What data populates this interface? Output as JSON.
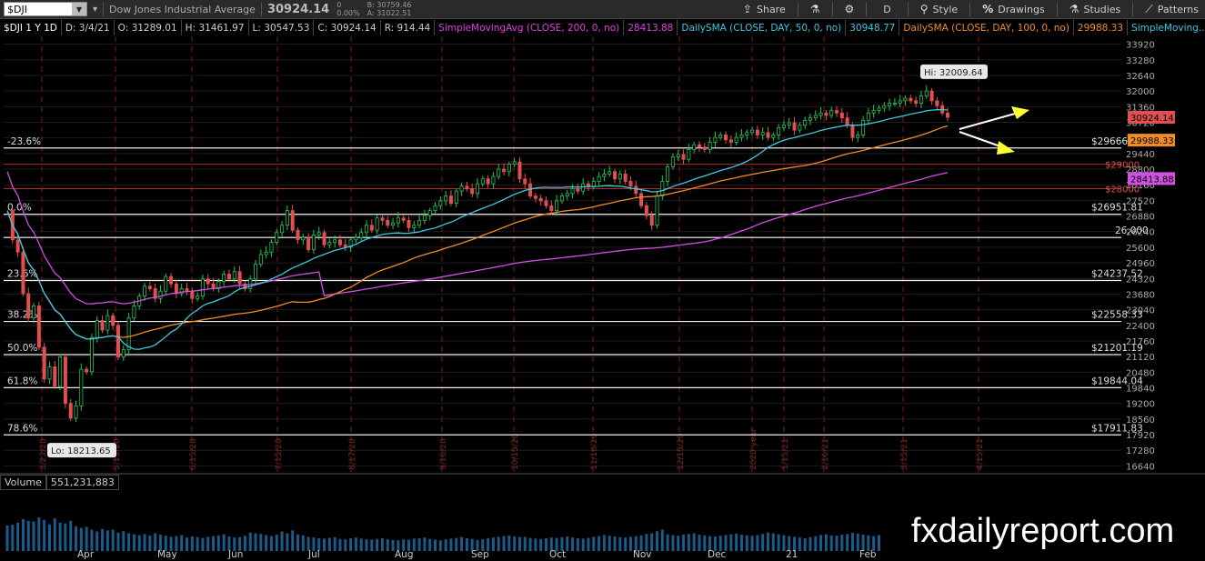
{
  "toolbar": {
    "symbol": "$DJI",
    "company": "Dow Jones Industrial Average",
    "last": "30924.14",
    "change": "0",
    "change_pct": "0.00%",
    "bid": "B: 30759.46",
    "ask": "A: 31022.51",
    "share": "Share",
    "period": "D",
    "style": "Style",
    "drawings": "Drawings",
    "studies": "Studies",
    "patterns": "Patterns"
  },
  "infobar": {
    "items": [
      {
        "text": "$DJI 1 Y 1D",
        "color": "#ffffff"
      },
      {
        "text": "D: 3/4/21",
        "color": "#cccccc"
      },
      {
        "text": "O: 31289.01",
        "color": "#cccccc"
      },
      {
        "text": "H: 31461.97",
        "color": "#cccccc"
      },
      {
        "text": "L: 30547.53",
        "color": "#cccccc"
      },
      {
        "text": "C: 30924.14",
        "color": "#cccccc"
      },
      {
        "text": "R: 914.44",
        "color": "#cccccc"
      },
      {
        "text": "SimpleMovingAvg (CLOSE, 200, 0, no)",
        "color": "#e040e0"
      },
      {
        "text": "28413.88",
        "color": "#e040e0"
      },
      {
        "text": "DailySMA (CLOSE, DAY, 50, 0, no)",
        "color": "#40c8e0"
      },
      {
        "text": "30948.77",
        "color": "#40c8e0"
      },
      {
        "text": "DailySMA (CLOSE, DAY, 100, 0, no)",
        "color": "#f08c28"
      },
      {
        "text": "29988.33",
        "color": "#f08c28"
      },
      {
        "text": "SimpleMoving...",
        "color": "#40c8e0"
      }
    ]
  },
  "colors": {
    "up": "#22c65a",
    "down": "#e05050",
    "sma50": "#3ec8e0",
    "sma100": "#f08c28",
    "sma200": "#d050e0",
    "grid": "#2a2a2a"
  },
  "chart_data": {
    "type": "candlestick",
    "xlabels": [
      "Apr",
      "May",
      "Jun",
      "Jul",
      "Aug",
      "Sep",
      "Oct",
      "Nov",
      "Dec",
      "21",
      "Feb"
    ],
    "date_markers": [
      "3/23/20",
      "5/15/20",
      "6/15/20",
      "7/15/20",
      "8/17/20",
      "9/16/20",
      "10/15/20",
      "11/16/20",
      "12/15/20",
      "2020 year",
      "1/15/21",
      "2/16/21",
      "3/15/21",
      "4/15/21"
    ],
    "yticks": [
      "33920",
      "33280",
      "32640",
      "32000",
      "31360",
      "30720",
      "30080",
      "29440",
      "28800",
      "28160",
      "27520",
      "26880",
      "26240",
      "25600",
      "24960",
      "24320",
      "23680",
      "23040",
      "22400",
      "21760",
      "21120",
      "20480",
      "19840",
      "19200",
      "18560",
      "17920",
      "17280",
      "16640"
    ],
    "ylim": [
      16320,
      34240
    ],
    "fib_levels": [
      {
        "pct": "-23.6%",
        "value": "$29666.11",
        "price": 29666.11
      },
      {
        "pct": "0.0%",
        "value": "$26951.81",
        "price": 26951.81
      },
      {
        "pct": "23.6%",
        "value": "$24237.52",
        "price": 24237.52
      },
      {
        "pct": "38.2%",
        "value": "$22558.33",
        "price": 22558.33
      },
      {
        "pct": "50.0%",
        "value": "$21201.19",
        "price": 21201.19
      },
      {
        "pct": "61.8%",
        "value": "$19844.04",
        "price": 19844.04
      },
      {
        "pct": "78.6%",
        "value": "$17911.83",
        "price": 17911.83
      }
    ],
    "level_26000": {
      "value": "26,000",
      "price": 26000
    },
    "red_levels": [
      {
        "value": "$29000",
        "price": 29000
      },
      {
        "value": "$28000",
        "price": 28000
      }
    ],
    "hi": {
      "text": "Hi: 32009.64",
      "price": 32009.64
    },
    "lo": {
      "text": "Lo: 18213.65",
      "price": 18213.65
    },
    "tags": [
      {
        "text": "30924.14",
        "price": 30924.14,
        "color": "#e05050"
      },
      {
        "text": "29988.33",
        "price": 29988.33,
        "color": "#f08c28"
      },
      {
        "text": "28413.88",
        "price": 28413.88,
        "color": "#d050e0"
      }
    ],
    "closes": [
      27100,
      25900,
      25400,
      23700,
      22700,
      23200,
      21500,
      20200,
      20700,
      19900,
      21100,
      19200,
      18600,
      19100,
      20600,
      20500,
      21900,
      22600,
      22200,
      22800,
      22400,
      21100,
      21400,
      22700,
      23200,
      23600,
      24000,
      23900,
      23500,
      23800,
      24400,
      24100,
      23700,
      23900,
      23800,
      23500,
      23600,
      24300,
      24100,
      23900,
      24200,
      24500,
      24300,
      24600,
      24100,
      23900,
      24300,
      24900,
      25300,
      25400,
      25800,
      26200,
      26500,
      27100,
      26300,
      25900,
      26000,
      25500,
      26100,
      26200,
      25700,
      25800,
      25900,
      25700,
      25600,
      25900,
      26000,
      26200,
      26500,
      26300,
      26800,
      26700,
      26500,
      26600,
      26800,
      26700,
      26400,
      26500,
      26700,
      26900,
      27100,
      27300,
      27500,
      27700,
      27400,
      27900,
      28100,
      28000,
      27800,
      28200,
      28400,
      28200,
      28500,
      28800,
      28700,
      29000,
      29100,
      28400,
      28200,
      27700,
      27600,
      27500,
      27300,
      27100,
      27500,
      27700,
      27800,
      28000,
      27900,
      28200,
      28100,
      28300,
      28500,
      28600,
      28700,
      28400,
      28600,
      28300,
      28100,
      27800,
      27300,
      26900,
      26500,
      27700,
      28300,
      28900,
      29300,
      29400,
      29200,
      29600,
      29800,
      29700,
      29600,
      29900,
      30100,
      30200,
      30000,
      29900,
      30100,
      30200,
      30300,
      30400,
      30200,
      30300,
      30100,
      30200,
      30500,
      30600,
      30700,
      30400,
      30600,
      30800,
      30900,
      31000,
      31100,
      31000,
      31200,
      31100,
      30900,
      30600,
      30100,
      30200,
      30800,
      31100,
      31200,
      31300,
      31400,
      31500,
      31500,
      31600,
      31700,
      31600,
      31500,
      31800,
      32000,
      31600,
      31400,
      31100,
      30924
    ],
    "volumes": [
      0.72,
      0.74,
      0.8,
      0.9,
      0.85,
      0.83,
      0.95,
      0.88,
      0.75,
      0.92,
      0.8,
      0.78,
      0.85,
      0.7,
      0.65,
      0.68,
      0.6,
      0.55,
      0.62,
      0.58,
      0.6,
      0.52,
      0.56,
      0.5,
      0.47,
      0.45,
      0.48,
      0.44,
      0.5,
      0.46,
      0.43,
      0.4,
      0.42,
      0.45,
      0.38,
      0.41,
      0.39,
      0.37,
      0.4,
      0.42,
      0.44,
      0.47,
      0.41,
      0.38,
      0.39,
      0.43,
      0.52,
      0.5,
      0.48,
      0.45,
      0.42,
      0.46,
      0.55,
      0.5,
      0.58,
      0.47,
      0.44,
      0.4,
      0.38,
      0.36,
      0.35,
      0.37,
      0.39,
      0.34,
      0.33,
      0.36,
      0.38,
      0.35,
      0.33,
      0.32,
      0.34,
      0.36,
      0.33,
      0.31,
      0.3,
      0.33,
      0.32,
      0.35,
      0.36,
      0.38,
      0.34,
      0.32,
      0.3,
      0.33,
      0.35,
      0.37,
      0.39,
      0.36,
      0.34,
      0.31,
      0.33,
      0.36,
      0.38,
      0.4,
      0.42,
      0.44,
      0.41,
      0.39,
      0.4,
      0.37,
      0.35,
      0.34,
      0.36,
      0.38,
      0.37,
      0.39,
      0.41,
      0.38,
      0.36,
      0.35,
      0.37,
      0.4,
      0.42,
      0.45,
      0.43,
      0.41,
      0.39,
      0.38,
      0.4,
      0.42,
      0.44,
      0.48,
      0.5,
      0.56,
      0.6,
      0.47,
      0.45,
      0.43,
      0.46,
      0.48,
      0.5,
      0.46,
      0.44,
      0.42,
      0.41,
      0.43,
      0.45,
      0.47,
      0.49,
      0.46,
      0.44,
      0.43,
      0.45,
      0.48,
      0.52,
      0.5,
      0.47,
      0.44,
      0.42,
      0.4,
      0.38,
      0.36,
      0.39,
      0.42,
      0.45,
      0.47,
      0.44,
      0.43,
      0.46,
      0.48,
      0.51,
      0.49,
      0.46,
      0.44,
      0.42,
      0.45,
      0.47,
      0.49,
      0.52,
      0.5,
      0.48,
      0.46,
      0.44,
      0.47,
      0.5,
      0.46,
      0.44,
      0.43,
      0.45,
      0.48,
      0.5,
      0.53,
      0.49,
      0.47,
      0.45,
      0.44
    ]
  },
  "volume": {
    "label": "Volume",
    "value": "551,231,883"
  },
  "watermark": "fxdailyreport.com"
}
